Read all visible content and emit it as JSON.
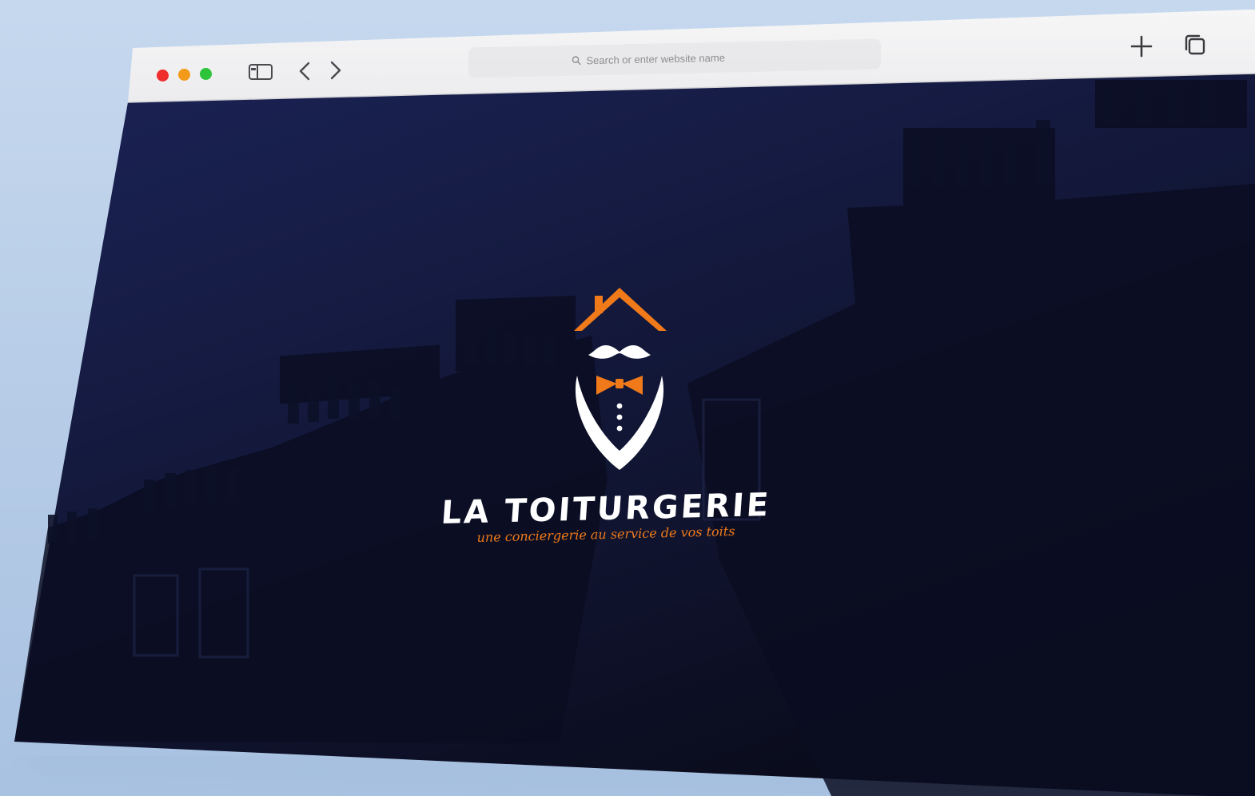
{
  "browser": {
    "address_bar": {
      "placeholder": "Search or enter website name"
    },
    "icons": {
      "traffic_lights": [
        "close-dot",
        "minimize-dot",
        "zoom-dot"
      ],
      "sidebar": "sidebar-icon",
      "back": "chevron-left-icon",
      "forward": "chevron-right-icon",
      "search": "search-icon",
      "new_tab": "plus-icon",
      "tab_overview": "tabs-overview-icon"
    },
    "colors": {
      "close": "#f02d2d",
      "minimize": "#f39a1b",
      "zoom": "#2dc43a"
    }
  },
  "page": {
    "brand": {
      "name": "LA TOITURGERIE",
      "tagline": "une conciergerie au service de vos toits"
    },
    "colors": {
      "background": "#131a3c",
      "accent": "#f07a1a",
      "text": "#ffffff"
    }
  }
}
